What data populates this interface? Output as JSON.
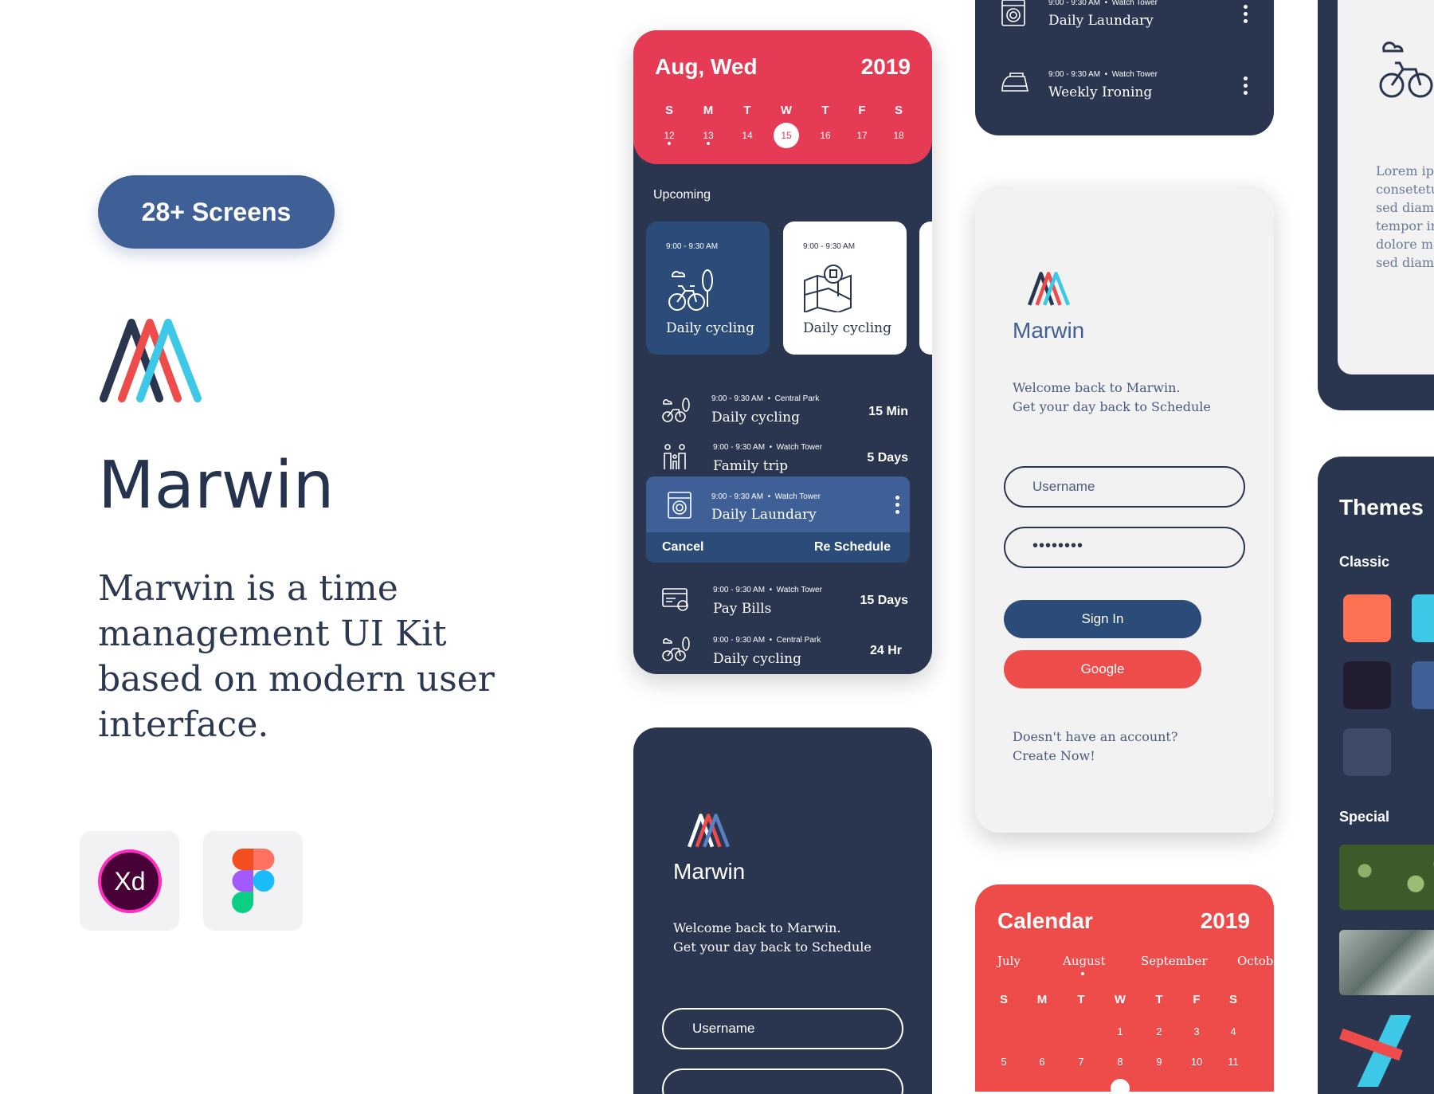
{
  "hero": {
    "badge": "28+ Screens",
    "title": "Marwin",
    "description": "Marwin is a time management UI Kit based on modern user interface.",
    "tools": [
      {
        "label": "Xd",
        "icon": "adobe-xd-icon"
      },
      {
        "icon": "figma-icon"
      }
    ]
  },
  "colors": {
    "red": "#e63b54",
    "navy": "#2a3550",
    "blue": "#3f5f97",
    "cyan": "#3cc8e6",
    "salmon": "#ee4b4b"
  },
  "schedule": {
    "month_day": "Aug, Wed",
    "year": "2019",
    "weekdays": [
      "S",
      "M",
      "T",
      "W",
      "T",
      "F",
      "S"
    ],
    "dates": [
      "12",
      "13",
      "14",
      "15",
      "16",
      "17",
      "18"
    ],
    "selected_date": "15",
    "section": "Upcoming",
    "tiles": [
      {
        "time": "9:00 - 9:30 AM",
        "label": "Daily cycling",
        "icon": "bicycle-icon"
      },
      {
        "time": "9:00 - 9:30 AM",
        "label": "Daily cycling",
        "icon": "map-icon"
      }
    ],
    "rows": [
      {
        "time": "9:00 - 9:30 AM",
        "place": "Central Park",
        "title": "Daily cycling",
        "duration": "15 Min",
        "icon": "bicycle-icon"
      },
      {
        "time": "9:00 - 9:30 AM",
        "place": "Watch Tower",
        "title": "Family trip",
        "duration": "5 Days",
        "icon": "family-icon"
      },
      {
        "time": "9:00 - 9:30 AM",
        "place": "Watch Tower",
        "title": "Daily Laundary",
        "duration": "",
        "icon": "washing-machine-icon"
      },
      {
        "time": "9:00 - 9:30 AM",
        "place": "Watch Tower",
        "title": "Pay Bills",
        "duration": "15 Days",
        "icon": "bills-icon"
      },
      {
        "time": "9:00 - 9:30 AM",
        "place": "Central Park",
        "title": "Daily cycling",
        "duration": "24 Hr",
        "icon": "bicycle-icon"
      }
    ],
    "actions": {
      "cancel": "Cancel",
      "reschedule": "Re Schedule"
    }
  },
  "top_snippet": {
    "rows": [
      {
        "time": "9:00 - 9:30 AM",
        "place": "Watch Tower",
        "title": "Daily Laundary",
        "icon": "washing-machine-icon"
      },
      {
        "time": "9:00 - 9:30 AM",
        "place": "Watch Tower",
        "title": "Weekly Ironing",
        "icon": "iron-icon"
      }
    ]
  },
  "login_light": {
    "brand": "Marwin",
    "welcome_line1": "Welcome back to Marwin.",
    "welcome_line2": "Get your day back to Schedule",
    "username_placeholder": "Username",
    "password_value": "••••••••",
    "signin": "Sign In",
    "google": "Google",
    "footer_line1": "Doesn't have an account?",
    "footer_line2": "Create Now!"
  },
  "login_dark": {
    "brand": "Marwin",
    "welcome_line1": "Welcome back to Marwin.",
    "welcome_line2": "Get your day back to Schedule",
    "username_placeholder": "Username"
  },
  "onboarding": {
    "lorem_lines": [
      "Lorem ips",
      "consetetu",
      "sed diam",
      "tempor in",
      "dolore ma",
      "sed diam"
    ]
  },
  "calendar": {
    "title": "Calendar",
    "year": "2019",
    "months": [
      "July",
      "August",
      "September",
      "Octobe"
    ],
    "weekdays": [
      "S",
      "M",
      "T",
      "W",
      "T",
      "F",
      "S"
    ],
    "week1": [
      "",
      "",
      "",
      "1",
      "2",
      "3",
      "4"
    ],
    "week2": [
      "5",
      "6",
      "7",
      "8",
      "9",
      "10",
      "11"
    ]
  },
  "themes": {
    "title": "Themes",
    "classic": "Classic",
    "special": "Special",
    "classic_colors": [
      "#ff7152",
      "#3cc8e6",
      "#211c2f",
      "#3f5f97",
      "#3d4a68"
    ]
  }
}
